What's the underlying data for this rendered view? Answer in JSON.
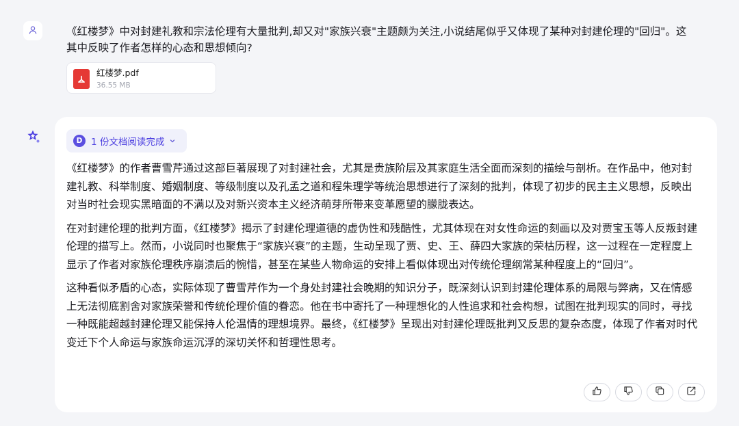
{
  "user": {
    "avatar_icon": "user-icon",
    "message": "《红楼梦》中对封建礼教和宗法伦理有大量批判,却又对\"家族兴衰\"主题颇为关注,小说结尾似乎又体现了某种对封建伦理的\"回归\"。这其中反映了作者怎样的心态和思想倾向?",
    "attachment": {
      "icon": "pdf-icon",
      "name": "红楼梦.pdf",
      "size": "36.55 MB"
    }
  },
  "assistant": {
    "avatar_icon": "assistant-logo-icon",
    "doc_status": {
      "badge": "D",
      "label": "1 份文档阅读完成"
    },
    "paragraphs": [
      "《红楼梦》的作者曹雪芹通过这部巨著展现了对封建社会，尤其是贵族阶层及其家庭生活全面而深刻的描绘与剖析。在作品中，他对封建礼教、科举制度、婚姻制度、等级制度以及孔孟之道和程朱理学等统治思想进行了深刻的批判，体现了初步的民主主义思想，反映出对当时社会现实黑暗面的不满以及对新兴资本主义经济萌芽所带来变革愿望的朦胧表达。",
      "在对封建伦理的批判方面，《红楼梦》揭示了封建伦理道德的虚伪性和残酷性，尤其体现在对女性命运的刻画以及对贾宝玉等人反叛封建伦理的描写上。然而，小说同时也聚焦于“家族兴衰”的主题，生动呈现了贾、史、王、薛四大家族的荣枯历程，这一过程在一定程度上显示了作者对家族伦理秩序崩溃后的惋惜，甚至在某些人物命运的安排上看似体现出对传统伦理纲常某种程度上的“回归”。",
      "这种看似矛盾的心态，实际体现了曹雪芹作为一个身处封建社会晚期的知识分子，既深刻认识到封建伦理体系的局限与弊病，又在情感上无法彻底割舍对家族荣誉和传统伦理价值的眷恋。他在书中寄托了一种理想化的人性追求和社会构想，试图在批判现实的同时，寻找一种既能超越封建伦理又能保持人伦温情的理想境界。最终，《红楼梦》呈现出对封建伦理既批判又反思的复杂态度，体现了作者对时代变迁下个人命运与家族命运沉浮的深切关怀和哲理性思考。"
    ],
    "actions": [
      {
        "icon": "thumbs-up-icon"
      },
      {
        "icon": "thumbs-down-icon"
      },
      {
        "icon": "copy-icon"
      },
      {
        "icon": "share-icon"
      }
    ]
  },
  "colors": {
    "page_bg": "#f4f5f8",
    "accent": "#4b3ee0",
    "pdf_red": "#e53935"
  }
}
